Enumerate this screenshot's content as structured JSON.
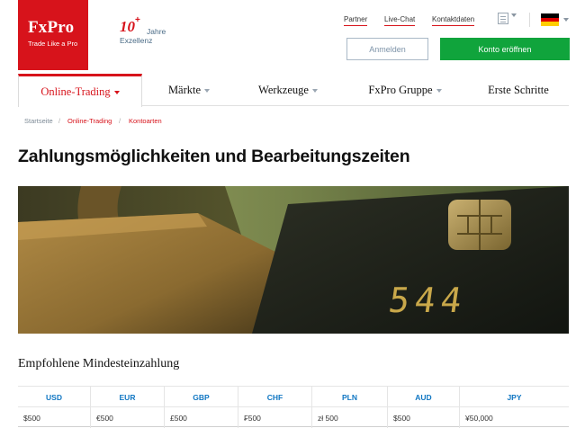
{
  "header": {
    "brand": "FxPro",
    "tagline": "Trade Like a Pro",
    "anniversary_number": "10",
    "anniversary_plus": "+",
    "anniversary_word": "Jahre",
    "anniversary_sub": "Exzellenz",
    "top_links": [
      "Partner",
      "Live-Chat",
      "Kontaktdaten"
    ],
    "login_label": "Anmelden",
    "open_account_label": "Konto eröffnen",
    "language_flag": "de",
    "colors": {
      "brand_red": "#d7131b",
      "green": "#10a43c",
      "blue": "#1177c3"
    }
  },
  "nav": {
    "items": [
      {
        "label": "Online-Trading",
        "active": true,
        "dropdown": true
      },
      {
        "label": "Märkte",
        "active": false,
        "dropdown": true
      },
      {
        "label": "Werkzeuge",
        "active": false,
        "dropdown": true
      },
      {
        "label": "FxPro Gruppe",
        "active": false,
        "dropdown": true
      },
      {
        "label": "Erste Schritte",
        "active": false,
        "dropdown": false
      }
    ]
  },
  "breadcrumb": {
    "items": [
      "Startseite",
      "Online-Trading",
      "Kontoarten"
    ],
    "separator": "/"
  },
  "page": {
    "title": "Zahlungsmöglichkeiten und Bearbeitungszeiten",
    "banner_card_digits": "544",
    "section_title": "Empfohlene Mindesteinzahlung"
  },
  "deposit_table": {
    "headers": [
      "USD",
      "EUR",
      "GBP",
      "CHF",
      "PLN",
      "AUD",
      "JPY"
    ],
    "values": [
      "$500",
      "€500",
      "£500",
      "₣500",
      "zł 500",
      "$500",
      "¥50,000"
    ]
  }
}
